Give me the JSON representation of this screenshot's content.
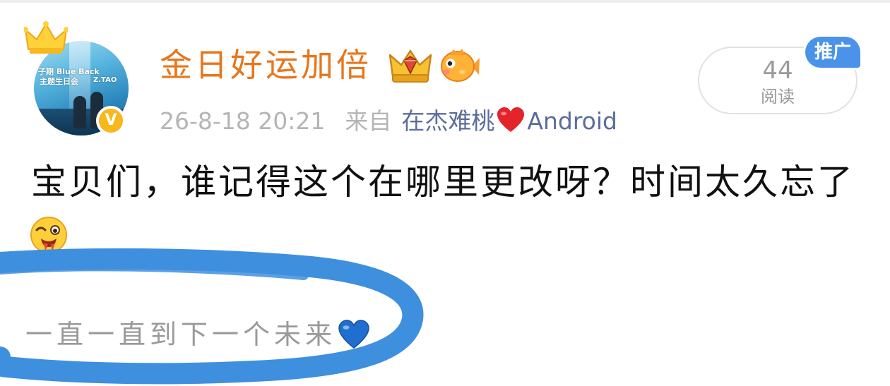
{
  "post": {
    "username": "金日好运加倍",
    "time": "26-8-18 20:21",
    "from_label": "来自",
    "source": "在杰难桃",
    "source_suffix": "Android",
    "read_count": "44",
    "read_label": "阅读",
    "promo_tag": "推广",
    "text": "宝贝们，谁记得这个在哪里更改呀？时间太久忘了",
    "avatar_caption": [
      "子期 Blue Back",
      "主题生日会",
      "Z.TAO"
    ],
    "verified_mark": "V"
  },
  "annotation": {
    "text": "一直一直到下一个未来",
    "circle_color": "#3f8fdf"
  },
  "colors": {
    "username": "#e8761c",
    "meta": "#b5b5b5",
    "source_link": "#5b6d9a",
    "promo": "#4b93e8",
    "body_text": "#111111"
  },
  "icons": {
    "username_badges": [
      "vip-crown-icon",
      "fish-icon"
    ],
    "source_badge": "heart-icon",
    "avatar_decoration": "crown-icon",
    "post_emoji": "drool-emoji-icon",
    "annotation_emoji": "blue-heart-icon"
  }
}
